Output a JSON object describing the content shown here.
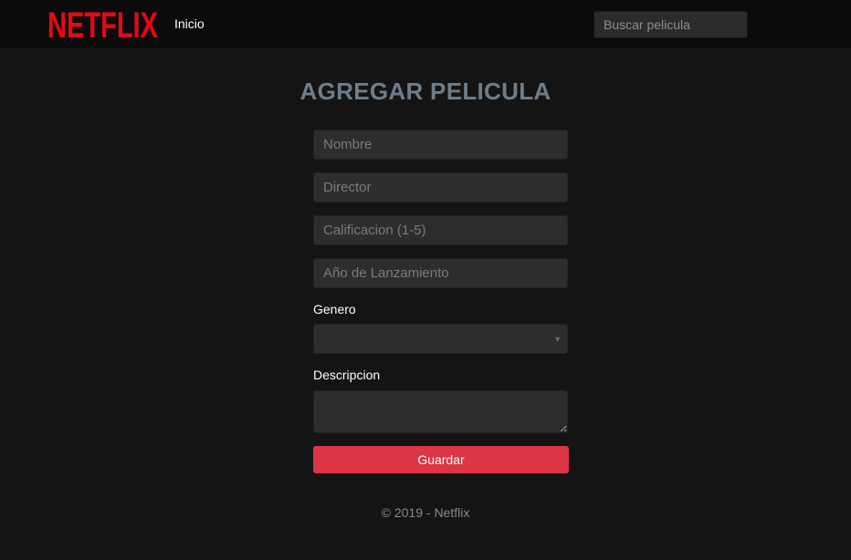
{
  "navbar": {
    "brand": "NETFLIX",
    "brand_color": "#e50914",
    "links": [
      {
        "label": "Inicio"
      }
    ],
    "search": {
      "placeholder": "Buscar pelicula",
      "value": ""
    }
  },
  "form": {
    "title": "AGREGAR PELICULA",
    "fields": {
      "nombre": {
        "placeholder": "Nombre",
        "value": ""
      },
      "director": {
        "placeholder": "Director",
        "value": ""
      },
      "calificacion": {
        "placeholder": "Calificacion (1-5)",
        "value": ""
      },
      "anio": {
        "placeholder": "Año de Lanzamiento",
        "value": ""
      }
    },
    "genero": {
      "label": "Genero",
      "selected": ""
    },
    "descripcion": {
      "label": "Descripcion",
      "value": ""
    },
    "submit_label": "Guardar",
    "submit_color": "#dc3545"
  },
  "footer": {
    "text": "© 2019 - Netflix"
  },
  "icons": {
    "select_caret": "chevron-down-icon"
  }
}
